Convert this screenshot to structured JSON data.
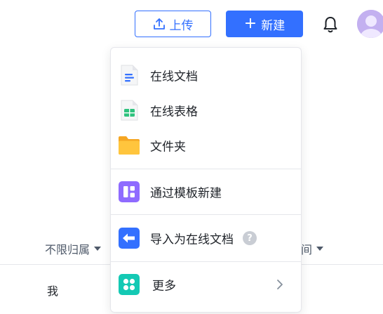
{
  "toolbar": {
    "upload_label": "上传",
    "new_label": "新建",
    "plus": "+"
  },
  "filters": {
    "owner_label": "不限归属",
    "time_label": "间"
  },
  "list": {
    "owner_value": "我"
  },
  "menu": {
    "items": [
      {
        "label": "在线文档",
        "icon": "doc-icon"
      },
      {
        "label": "在线表格",
        "icon": "sheet-icon"
      },
      {
        "label": "文件夹",
        "icon": "folder-icon"
      },
      {
        "label": "通过模板新建",
        "icon": "template-icon"
      },
      {
        "label": "导入为在线文档",
        "icon": "import-icon",
        "help": "?"
      },
      {
        "label": "更多",
        "icon": "more-icon"
      }
    ]
  },
  "colors": {
    "primary": "#3370ff",
    "sheet_green": "#2ec27e",
    "folder_yellow": "#ffc53d",
    "template_purple": "#8f6bff",
    "more_teal": "#14c9b4",
    "help_gray": "#c9cdd4"
  }
}
